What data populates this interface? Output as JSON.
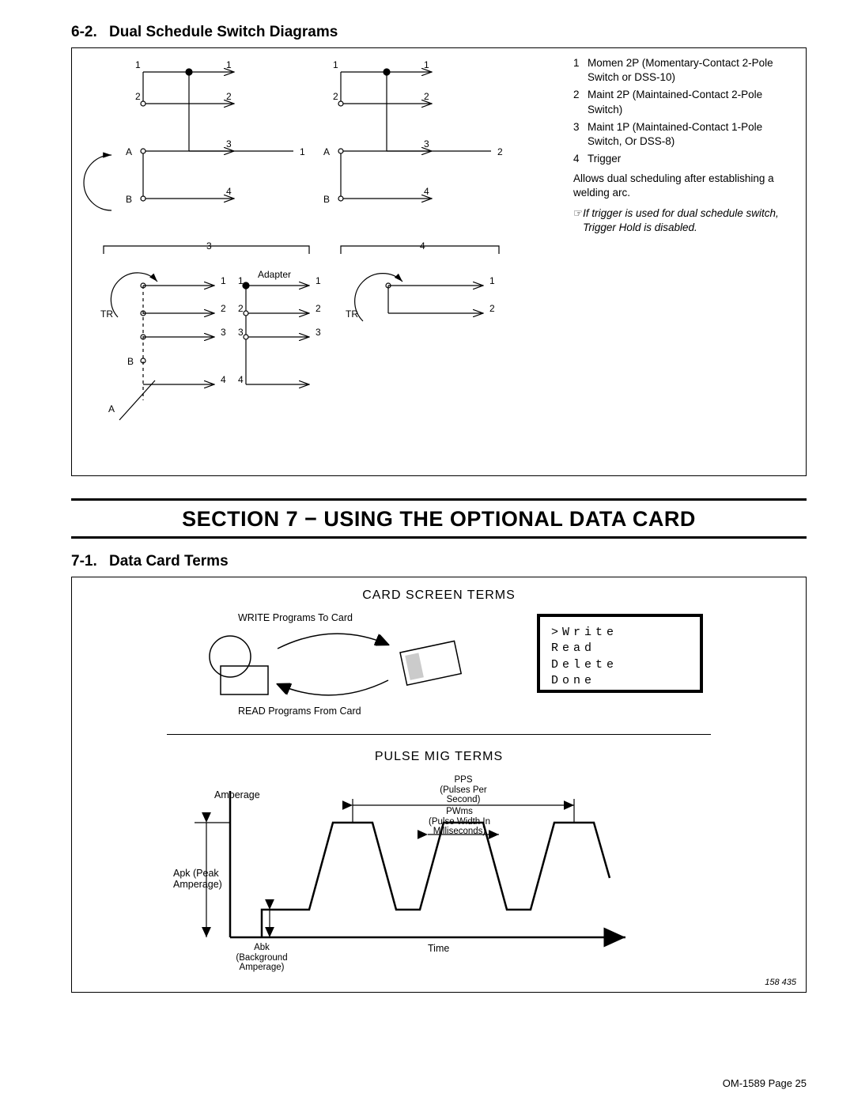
{
  "section62": {
    "num": "6-2.",
    "title": "Dual Schedule Switch Diagrams"
  },
  "legend": {
    "items": [
      {
        "n": "1",
        "t": "Momen 2P (Momentary-Contact 2-Pole Switch or DSS-10)"
      },
      {
        "n": "2",
        "t": "Maint 2P (Maintained-Contact 2-Pole Switch)"
      },
      {
        "n": "3",
        "t": "Maint 1P (Maintained-Contact 1-Pole Switch, Or DSS-8)"
      },
      {
        "n": "4",
        "t": "Trigger"
      }
    ],
    "allows": "Allows dual scheduling after establishing a welding arc.",
    "note": "If trigger is used for dual schedule switch, Trigger Hold is disabled."
  },
  "diag": {
    "top": {
      "n1": "1",
      "n2": "2",
      "n3": "3",
      "n4": "4",
      "a": "A",
      "b": "B",
      "far1": "1",
      "far2": "2"
    },
    "bot": {
      "n3": "3",
      "n4": "4",
      "n1": "1",
      "n2": "2",
      "nn3": "3",
      "nn4": "4",
      "adapter": "Adapter",
      "tr": "TR",
      "b": "B",
      "a": "A"
    }
  },
  "section7": {
    "title": "SECTION 7 − USING THE OPTIONAL DATA CARD"
  },
  "section71": {
    "num": "7-1.",
    "title": "Data Card Terms"
  },
  "card": {
    "heading": "CARD SCREEN TERMS",
    "write": "WRITE Programs To Card",
    "read": "READ Programs From Card",
    "screen": {
      "l1": ">Write",
      "l2": " Read",
      "l3": " Delete",
      "l4": " Done"
    }
  },
  "pulse": {
    "heading": "PULSE MIG TERMS",
    "amperage": "Amperage",
    "pps1": "PPS",
    "pps2": "(Pulses Per",
    "pps3": "Second)",
    "pw1": "PWms",
    "pw2": "(Pulse Width In",
    "pw3": "Milliseconds)",
    "apk": "Apk (Peak Amperage)",
    "abk1": "Abk",
    "abk2": "(Background",
    "abk3": "Amperage)",
    "time": "Time"
  },
  "figno": "158 435",
  "footer": "OM-1589 Page 25"
}
